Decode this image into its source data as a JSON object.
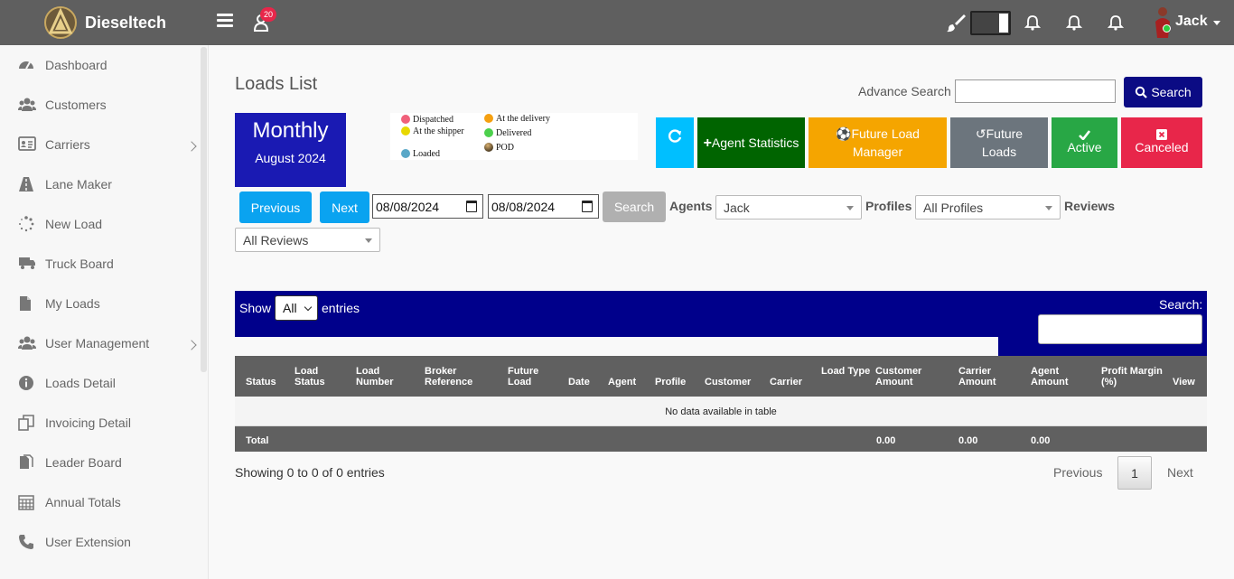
{
  "topbar": {
    "brand": "Dieseltech",
    "notification_count": "20",
    "username": "Jack"
  },
  "sidebar": {
    "items": [
      {
        "label": "Dashboard",
        "icon": "dashboard-icon"
      },
      {
        "label": "Customers",
        "icon": "users-icon"
      },
      {
        "label": "Carriers",
        "icon": "id-card-icon",
        "has_submenu": true
      },
      {
        "label": "Lane Maker",
        "icon": "road-icon"
      },
      {
        "label": "New Load",
        "icon": "spinner-icon"
      },
      {
        "label": "Truck Board",
        "icon": "truck-icon"
      },
      {
        "label": "My Loads",
        "icon": "file-icon"
      },
      {
        "label": "User Management",
        "icon": "users-icon",
        "has_submenu": true
      },
      {
        "label": "Loads Detail",
        "icon": "info-icon"
      },
      {
        "label": "Invoicing Detail",
        "icon": "copy-icon"
      },
      {
        "label": "Leader Board",
        "icon": "files-icon"
      },
      {
        "label": "Annual Totals",
        "icon": "calendar-icon"
      },
      {
        "label": "User Extension",
        "icon": "phone-icon"
      }
    ]
  },
  "main": {
    "title": "Loads List",
    "advance_search_label": "Advance Search",
    "advance_search_value": "",
    "search_button": "Search",
    "period": {
      "title": "Monthly",
      "subtitle": "August 2024"
    },
    "legend": [
      {
        "label": "Dispatched",
        "color": "#f0607a"
      },
      {
        "label": "At the shipper",
        "color": "#e8d800"
      },
      {
        "label": "Loaded",
        "color": "#5aa8c8"
      },
      {
        "label": "At the delivery",
        "color": "#f5a010"
      },
      {
        "label": "Delivered",
        "color": "#4cd04c"
      },
      {
        "label": "POD",
        "color": "#6b4a1e"
      }
    ],
    "toolbar": {
      "refresh_color": "#00bfff",
      "agent_statistics": "Agent Statistics",
      "future_load_manager": "Future Load Manager",
      "future_loads": "Future Loads",
      "active": "Active",
      "canceled": "Canceled"
    },
    "filters": {
      "previous": "Previous",
      "next": "Next",
      "date_from": "08/08/2024",
      "date_to": "08/08/2024",
      "search": "Search",
      "agents_label": "Agents",
      "agents_value": "Jack",
      "profiles_label": "Profiles",
      "profiles_value": "All Profiles",
      "reviews_label": "Reviews",
      "reviews_value": "All Reviews"
    },
    "table": {
      "show_label": "Show",
      "show_value": "All",
      "entries_label": "entries",
      "search_label": "Search:",
      "search_value": "",
      "columns": [
        "Status",
        "Load Status",
        "Load Number",
        "Broker Reference",
        "Future Load",
        "Date",
        "Agent",
        "Profile",
        "Customer",
        "Carrier",
        "Load Type",
        "Customer Amount",
        "Carrier Amount",
        "Agent Amount",
        "Profit Margin (%)",
        "View"
      ],
      "empty_message": "No data available in table",
      "footer": {
        "total_label": "Total",
        "customer_amount": "0.00",
        "carrier_amount": "0.00",
        "agent_amount": "0.00"
      },
      "info": "Showing 0 to 0 of 0 entries",
      "pagination": {
        "previous": "Previous",
        "page": "1",
        "next": "Next"
      }
    }
  }
}
